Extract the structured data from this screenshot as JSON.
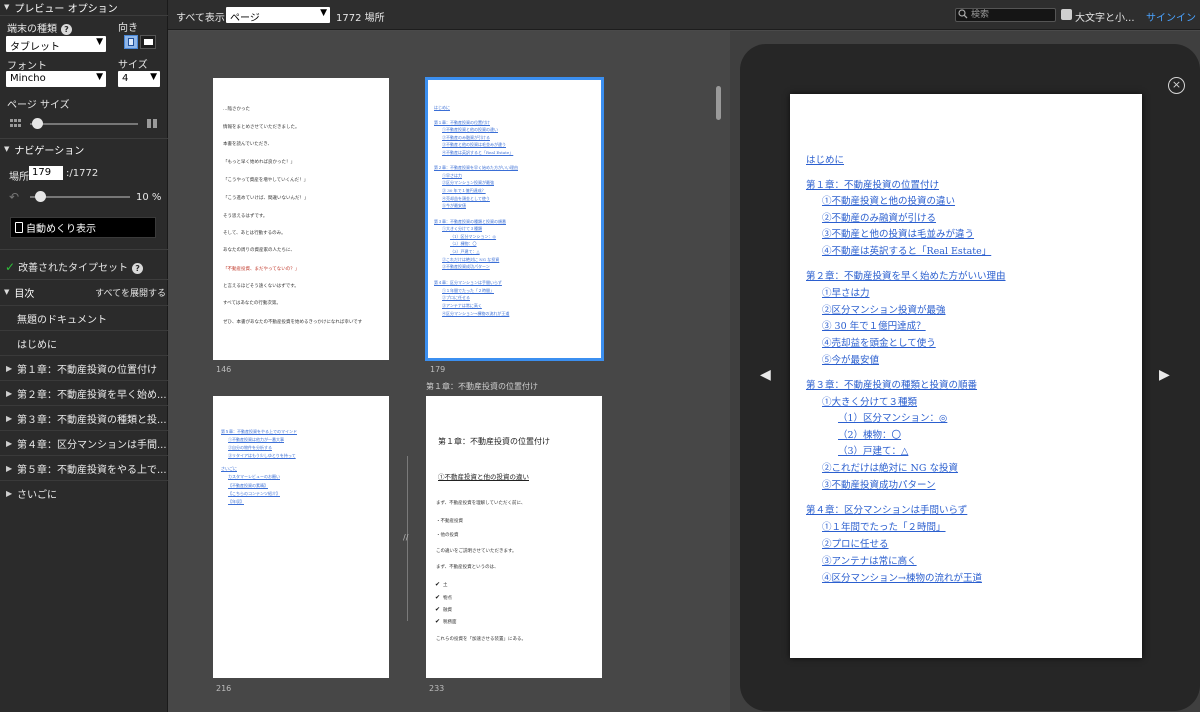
{
  "left": {
    "preview_options": "プレビュー オプション",
    "device_type_label": "端末の種類",
    "orientation_label": "向き",
    "device_value": "タブレット",
    "font_label": "フォント",
    "size_label": "サイズ",
    "font_value": "Mincho",
    "size_value": "4",
    "page_size_label": "ページ サイズ",
    "navigation": "ナビゲーション",
    "location_label": "場所",
    "location_value": "179",
    "location_total": ":/1772",
    "progress_percent": "10 %",
    "progress_fraction": 0.1,
    "autoflip": "自動めくり表示",
    "typeset": "改善されたタイプセット",
    "toc": "目次",
    "expand_all": "すべてを展開する",
    "toc_items": [
      {
        "label": "無題のドキュメント",
        "expandable": false
      },
      {
        "label": "はじめに",
        "expandable": false
      },
      {
        "label": "第１章：不動産投資の位置付け",
        "expandable": true
      },
      {
        "label": "第２章：不動産投資を早く始め...",
        "expandable": true
      },
      {
        "label": "第３章：不動産投資の種類と投...",
        "expandable": true
      },
      {
        "label": "第４章：区分マンションは手間...",
        "expandable": true
      },
      {
        "label": "第５章：不動産投資をやる上で...",
        "expandable": true
      },
      {
        "label": "さいごに",
        "expandable": true
      }
    ]
  },
  "topbar": {
    "show_all": "すべて表示",
    "view_select": "ページ",
    "locations": "1772 場所",
    "search_placeholder": "検索",
    "case_label": "大文字と小...",
    "signin": "サインイン"
  },
  "grid": {
    "page146": {
      "number": "146",
      "lines": [
        "…陥さかった",
        "情報をまとめさせていただきました。",
        "本書を読んでいただき、",
        "「もっと早く始めれば良かった！」",
        "「こうやって資産を増やしていくんだ！」",
        "「こう進めていけば、間違いないんだ！」",
        "そう思えるはずです。",
        "そして、あとは行動するのみ。",
        "あなたの周りの資産家の人たちに、",
        "「不動産投資、まだやってないの？」",
        "と言えるほどそう遠くないはずです。",
        "すべてはあなたの行動次第。",
        "ぜひ、本書があなたの不動産投資を始めるきっかけになれば幸いです"
      ]
    },
    "page179": {
      "number": "179",
      "chapter": "第１章：不動産投資の位置付け",
      "links": [
        "はじめに",
        "第１章：不動産投資の位置付け",
        "①不動産投資と他の投資の違い",
        "②不動産のみ融資が引ける",
        "③不動産と他の投資は毛並みが違う",
        "④不動産は英訳すると「Real Estate」",
        "第２章：不動産投資を早く始めた方がいい理由",
        "①早さは力",
        "②区分マンション投資が最強",
        "③ 30 年で１億円達成？",
        "④売却益を頭金として使う",
        "⑤今が最安値",
        "第３章：不動産投資の種類と投資の順番",
        "①大きく分けて３種類",
        "（1）区分マンション：◎",
        "（2）棟物：〇",
        "（3）戸建て：△",
        "②これだけは絶対に NG な投資",
        "③不動産投資成功パターン",
        "第４章：区分マンションは手間いらず",
        "①１年間でたった「２時間」",
        "②プロに任せる",
        "③アンテナは常に高く",
        "④区分マンション→棟物の流れが王道"
      ]
    },
    "page216": {
      "number": "216",
      "links": [
        "第５章：不動産投資をやる上でのマインド",
        "①不動産投資は他力が一番大事",
        "②自分の物件を分析する",
        "③リタイアはもう少しゆとりを持って",
        "さいごに",
        "カスタマーレビューのお願い",
        "【不動産投資の素晴】",
        "【こちらのコンテンツ紹介】",
        "【年収】"
      ]
    },
    "page233": {
      "number": "233",
      "title": "第１章：不動産投資の位置付け",
      "section": "①不動産投資と他の投資の違い",
      "lines": [
        "まず、不動産投資を理解していただく前に、",
        "・不動産投資",
        "・他の投資",
        "この違いをご説明させていただきます。",
        "まず、不動産投資というのは、",
        "土",
        "物点",
        "融資",
        "税務面",
        "これらの投資を「加速させる装置」にある。"
      ]
    }
  },
  "preview": {
    "links": [
      {
        "text": "はじめに",
        "level": 0
      },
      {
        "text": "第１章：不動産投資の位置付け",
        "level": 0
      },
      {
        "text": "①不動産投資と他の投資の違い",
        "level": 1
      },
      {
        "text": "②不動産のみ融資が引ける",
        "level": 1
      },
      {
        "text": "③不動産と他の投資は毛並みが違う",
        "level": 1
      },
      {
        "text": "④不動産は英訳すると「Real Estate」",
        "level": 1
      },
      {
        "text": "第２章：不動産投資を早く始めた方がいい理由",
        "level": 0
      },
      {
        "text": "①早さは力",
        "level": 1
      },
      {
        "text": "②区分マンション投資が最強",
        "level": 1
      },
      {
        "text": "③ 30 年で１億円達成？",
        "level": 1
      },
      {
        "text": "④売却益を頭金として使う",
        "level": 1
      },
      {
        "text": "⑤今が最安値",
        "level": 1
      },
      {
        "text": "第３章：不動産投資の種類と投資の順番",
        "level": 0
      },
      {
        "text": "①大きく分けて３種類",
        "level": 1
      },
      {
        "text": "（1）区分マンション：◎",
        "level": 2
      },
      {
        "text": "（2）棟物：〇",
        "level": 2
      },
      {
        "text": "（3）戸建て：△",
        "level": 2
      },
      {
        "text": "②これだけは絶対に NG な投資",
        "level": 1
      },
      {
        "text": "③不動産投資成功パターン",
        "level": 1
      },
      {
        "text": "第４章：区分マンションは手間いらず",
        "level": 0
      },
      {
        "text": "①１年間でたった「２時間」",
        "level": 1
      },
      {
        "text": "②プロに任せる",
        "level": 1
      },
      {
        "text": "③アンテナは常に高く",
        "level": 1
      },
      {
        "text": "④区分マンション→棟物の流れが王道",
        "level": 1
      }
    ]
  }
}
